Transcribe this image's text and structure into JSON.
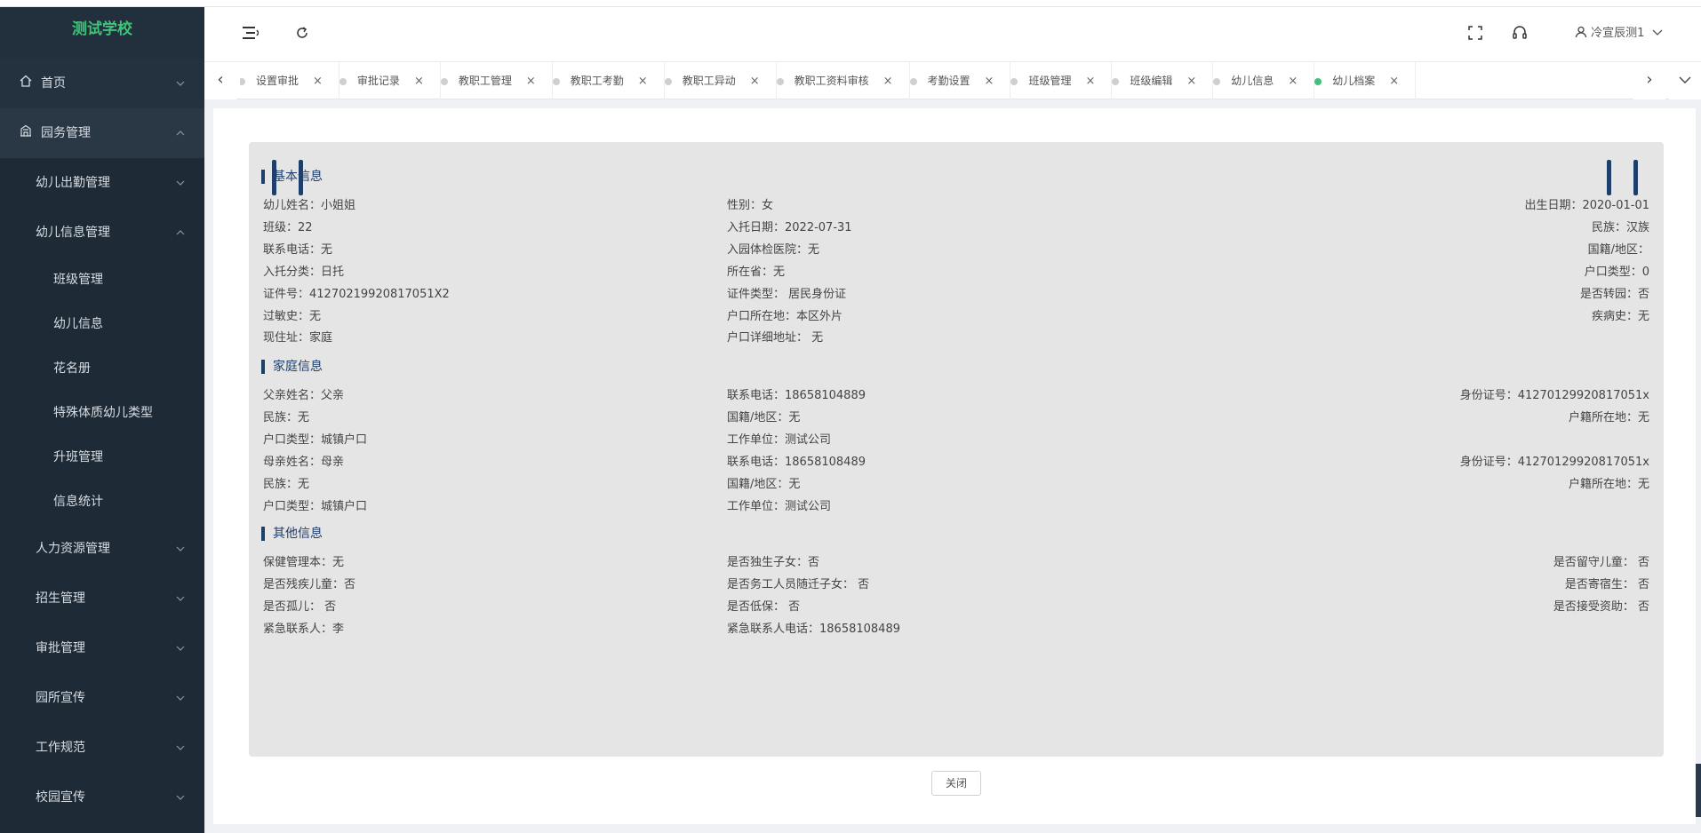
{
  "app": {
    "school_name": "测试学校"
  },
  "header": {
    "user_name": "冷宣辰测1"
  },
  "sidebar": {
    "items": [
      {
        "label": "首页",
        "level": 1,
        "icon": "home-icon",
        "expanded": false
      },
      {
        "label": "园务管理",
        "level": 1,
        "icon": "building-icon",
        "expanded": true
      },
      {
        "label": "幼儿出勤管理",
        "level": 2,
        "expanded": false
      },
      {
        "label": "幼儿信息管理",
        "level": 2,
        "expanded": true
      },
      {
        "label": "班级管理",
        "level": 3
      },
      {
        "label": "幼儿信息",
        "level": 3
      },
      {
        "label": "花名册",
        "level": 3
      },
      {
        "label": "特殊体质幼儿类型",
        "level": 3
      },
      {
        "label": "升班管理",
        "level": 3
      },
      {
        "label": "信息统计",
        "level": 3
      },
      {
        "label": "人力资源管理",
        "level": 2,
        "expanded": false
      },
      {
        "label": "招生管理",
        "level": 2,
        "expanded": false
      },
      {
        "label": "审批管理",
        "level": 2,
        "expanded": false
      },
      {
        "label": "园所宣传",
        "level": 2,
        "expanded": false
      },
      {
        "label": "工作规范",
        "level": 2,
        "expanded": false
      },
      {
        "label": "校园宣传",
        "level": 2,
        "expanded": false
      }
    ]
  },
  "tabs": [
    {
      "label": "设置审批",
      "active": false
    },
    {
      "label": "审批记录",
      "active": false
    },
    {
      "label": "教职工管理",
      "active": false
    },
    {
      "label": "教职工考勤",
      "active": false
    },
    {
      "label": "教职工异动",
      "active": false
    },
    {
      "label": "教职工资料审核",
      "active": false
    },
    {
      "label": "考勤设置",
      "active": false
    },
    {
      "label": "班级管理",
      "active": false
    },
    {
      "label": "班级编辑",
      "active": false
    },
    {
      "label": "幼儿信息",
      "active": false
    },
    {
      "label": "幼儿档案",
      "active": true
    }
  ],
  "sections": {
    "basic": {
      "title": "基本信息",
      "rows": [
        [
          "幼儿姓名：小姐姐",
          "性别：女",
          "出生日期：2020-01-01"
        ],
        [
          "班级：22",
          "入托日期：2022-07-31",
          "民族：汉族"
        ],
        [
          "联系电话：无",
          "入园体检医院：无",
          "国籍/地区："
        ],
        [
          "入托分类：日托",
          "所在省：无",
          "户口类型：0"
        ],
        [
          "证件号：41270219920817051X2",
          "证件类型： 居民身份证",
          "是否转园：否"
        ],
        [
          "过敏史：无",
          "户口所在地：本区外片",
          "疾病史：无"
        ],
        [
          "现住址：家庭",
          "户口详细地址： 无",
          ""
        ]
      ]
    },
    "family": {
      "title": "家庭信息",
      "rows": [
        [
          "父亲姓名：父亲",
          "联系电话：18658104889",
          "身份证号：41270129920817051x"
        ],
        [
          "民族：无",
          "国籍/地区：无",
          "户籍所在地：无"
        ],
        [
          "户口类型：城镇户口",
          "工作单位：测试公司",
          ""
        ],
        [
          "母亲姓名：母亲",
          "联系电话：18658108489",
          "身份证号：41270129920817051x"
        ],
        [
          "民族：无",
          "国籍/地区：无",
          "户籍所在地：无"
        ],
        [
          "户口类型：城镇户口",
          "工作单位：测试公司",
          ""
        ]
      ]
    },
    "other": {
      "title": "其他信息",
      "rows": [
        [
          "保健管理本：无",
          "是否独生子女：否",
          "是否留守儿童： 否"
        ],
        [
          "是否残疾儿童：否",
          "是否务工人员随迁子女： 否",
          "是否寄宿生： 否"
        ],
        [
          "是否孤儿： 否",
          "是否低保： 否",
          "是否接受资助： 否"
        ],
        [
          "紧急联系人：李",
          "紧急联系人电话：18658108489",
          ""
        ]
      ]
    }
  },
  "actions": {
    "close_label": "关闭"
  },
  "colors": {
    "sidebar_bg": "#1e2a36",
    "logo_text": "#3fc37a",
    "accent": "#1f3f6b",
    "active_tab_dot": "#3fc37a"
  }
}
